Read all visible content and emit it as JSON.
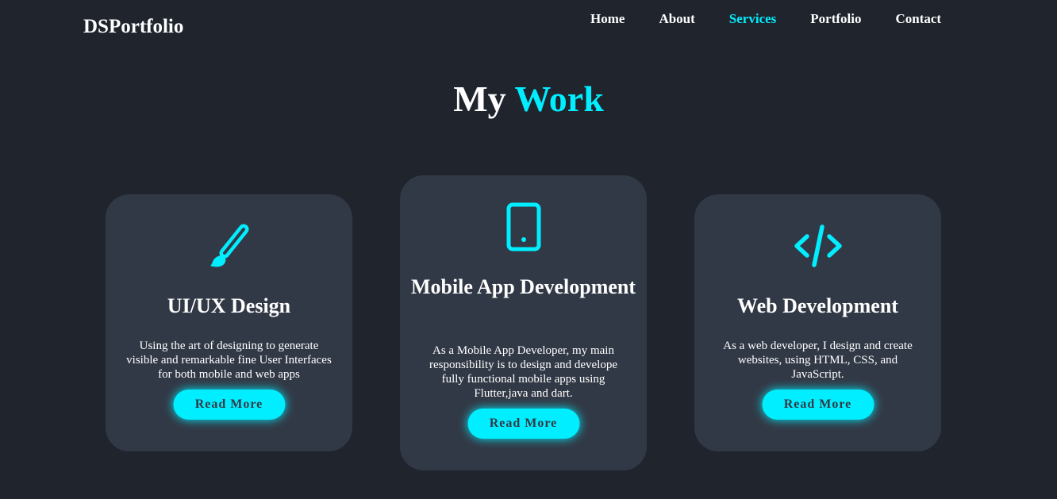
{
  "header": {
    "logo": "DSPortfolio",
    "nav": [
      {
        "label": "Home",
        "active": false
      },
      {
        "label": "About",
        "active": false
      },
      {
        "label": "Services",
        "active": true
      },
      {
        "label": "Portfolio",
        "active": false
      },
      {
        "label": "Contact",
        "active": false
      }
    ]
  },
  "section": {
    "heading_main": "My",
    "heading_accent": "Work"
  },
  "cards": [
    {
      "icon": "paintbrush-icon",
      "title": "UI/UX Design",
      "description": "Using the art of designing to generate visible and remarkable fine User Interfaces for both mobile and web apps",
      "button": "Read More"
    },
    {
      "icon": "mobile-phone-icon",
      "title": "Mobile App Development",
      "description": "As a Mobile App Developer, my main responsibility is to design and develope fully functional mobile apps using Flutter,java and dart.",
      "button": "Read More"
    },
    {
      "icon": "code-icon",
      "title": "Web Development",
      "description": "As a web developer, I design and create websites, using HTML, CSS, and JavaScript.",
      "button": "Read More"
    }
  ],
  "colors": {
    "background": "#1f242d",
    "card": "#323946",
    "accent": "#00eeff",
    "text": "#ffffff"
  }
}
